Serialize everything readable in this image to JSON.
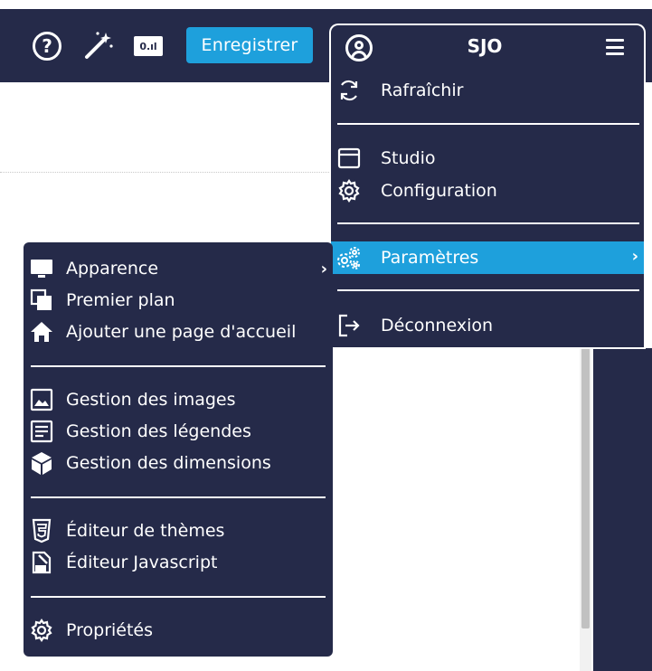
{
  "toolbar": {
    "save_label": "Enregistrer",
    "help_icon": "question-circle-icon",
    "wand_icon": "magic-wand-icon",
    "score_icon": "scoreboard-icon",
    "score_text": "0.ıl"
  },
  "user": {
    "name": "SJO",
    "avatar_icon": "user-circle-icon",
    "menu_icon": "hamburger-icon"
  },
  "user_menu": {
    "items": [
      {
        "label": "Rafraîchir",
        "icon": "refresh-icon"
      },
      {
        "label": "Studio",
        "icon": "window-icon"
      },
      {
        "label": "Configuration",
        "icon": "gear-icon"
      },
      {
        "label": "Paramètres",
        "icon": "cogs-icon",
        "active": true,
        "chevron": "›"
      },
      {
        "label": "Déconnexion",
        "icon": "logout-icon"
      }
    ]
  },
  "settings_submenu": {
    "items": [
      {
        "label": "Apparence",
        "icon": "monitor-icon",
        "chevron": "›"
      },
      {
        "label": "Premier plan",
        "icon": "layers-icon"
      },
      {
        "label": "Ajouter une page d'accueil",
        "icon": "home-icon"
      },
      {
        "label": "Gestion des images",
        "icon": "image-icon"
      },
      {
        "label": "Gestion des légendes",
        "icon": "legend-icon"
      },
      {
        "label": "Gestion des dimensions",
        "icon": "cube-icon"
      },
      {
        "label": "Éditeur de thèmes",
        "icon": "css3-icon"
      },
      {
        "label": "Éditeur Javascript",
        "icon": "js-file-icon"
      },
      {
        "label": "Propriétés",
        "icon": "gear-icon"
      }
    ]
  },
  "colors": {
    "navy": "#252a49",
    "accent": "#1ea0dc",
    "text": "#ffffff"
  }
}
